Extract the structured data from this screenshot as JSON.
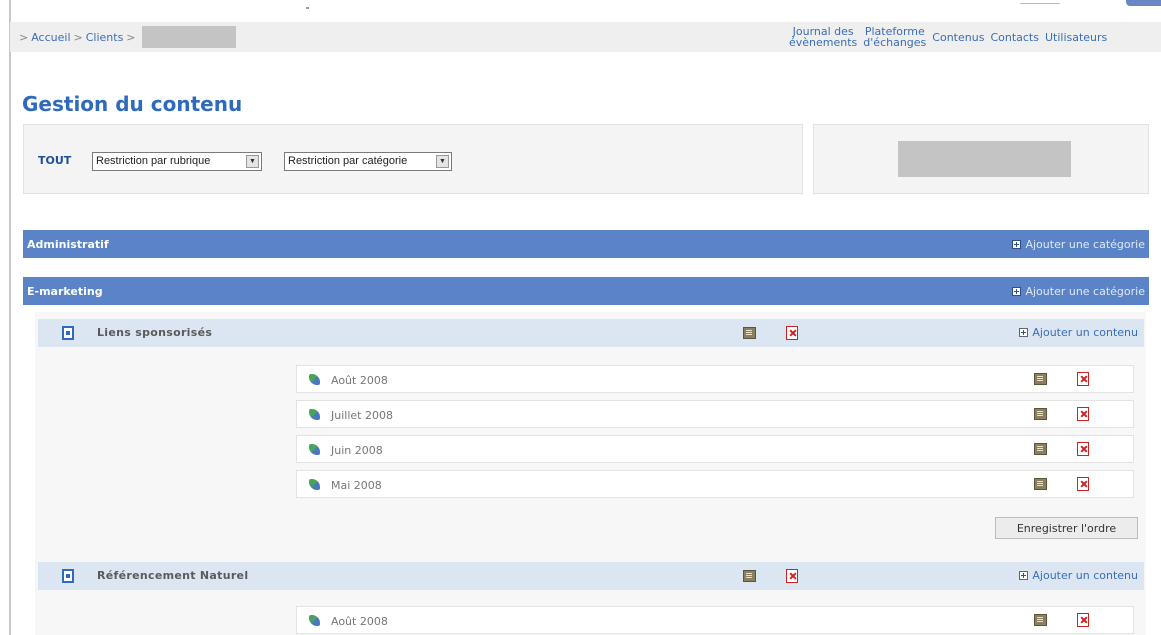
{
  "header": {
    "breadcrumb": [
      "Accueil",
      "Clients"
    ],
    "breadcrumb_sep": ">",
    "nav": [
      {
        "line1": "Journal des",
        "line2": "évènements"
      },
      {
        "line1": "Plateforme",
        "line2": "d'échanges"
      },
      {
        "line1": "Contenus",
        "line2": ""
      },
      {
        "line1": "Contacts",
        "line2": ""
      },
      {
        "line1": "Utilisateurs",
        "line2": ""
      }
    ]
  },
  "page": {
    "title": "Gestion du contenu"
  },
  "filters": {
    "all_label": "TOUT",
    "rubric_select": "Restriction par rubrique",
    "category_select": "Restriction par catégorie"
  },
  "rubrics": [
    {
      "name": "Administratif",
      "add_label": "Ajouter une catégorie"
    },
    {
      "name": "E-marketing",
      "add_label": "Ajouter une catégorie"
    }
  ],
  "categories": [
    {
      "name": "Liens sponsorisés",
      "add_label": "Ajouter un contenu",
      "items": [
        "Août 2008",
        "Juillet 2008",
        "Juin 2008",
        "Mai 2008"
      ]
    },
    {
      "name": "Référencement Naturel",
      "add_label": "Ajouter un contenu",
      "items": [
        "Août 2008"
      ]
    }
  ],
  "save_order_label": "Enregistrer l'ordre",
  "colors": {
    "rubric_bar": "#5a83c8",
    "category_bar": "#dce6f3",
    "title_blue": "#2f6bbd"
  }
}
